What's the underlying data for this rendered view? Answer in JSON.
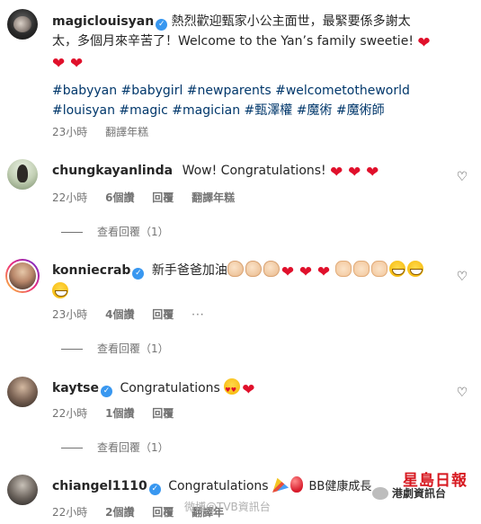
{
  "post": {
    "username": "magiclouisyan",
    "caption_line1": "熱烈歡迎甄家小公主面世，最緊要係多謝太",
    "caption_line2": "太，多個月來辛苦了！Welcome to the Yan’s family sweetie!",
    "hashtags_line1": "#babyyan #babygirl #newparents #welcometotheworld",
    "hashtags_line2": "#louisyan #magic #magician #甄澤權 #魔術 #魔術師",
    "time": "23小時",
    "translate": "翻譯年糕"
  },
  "comments": [
    {
      "username": "chungkayanlinda",
      "text": "Wow! Congratulations!",
      "time": "22小時",
      "likes": "6個讚",
      "reply": "回覆",
      "translate": "翻譯年糕",
      "view_replies": "查看回覆（1）",
      "verified": false
    },
    {
      "username": "konniecrab",
      "text": "新手爸爸加油",
      "time": "23小時",
      "likes": "4個讚",
      "reply": "回覆",
      "view_replies": "查看回覆（1）",
      "verified": true
    },
    {
      "username": "kaytse",
      "text": "Congratulations",
      "time": "22小時",
      "likes": "1個讚",
      "reply": "回覆",
      "view_replies": "查看回覆（1）",
      "verified": true
    },
    {
      "username": "chiangel1110",
      "text": "Congratulations",
      "text2": "BB健康成長",
      "time": "22小時",
      "likes": "2個讚",
      "reply": "回覆",
      "translate": "翻譯年",
      "verified": true
    }
  ],
  "watermark": {
    "logo_line1": "星島日報",
    "logo_line2": "港劇資訊台",
    "weibo": "微博@TVB資訊台"
  },
  "colors": {
    "text": "#262626",
    "meta": "#737373",
    "hashtag": "#00376b",
    "verified": "#3897f0",
    "heart_emoji": "#e0102b",
    "logo_red": "#d71920"
  }
}
